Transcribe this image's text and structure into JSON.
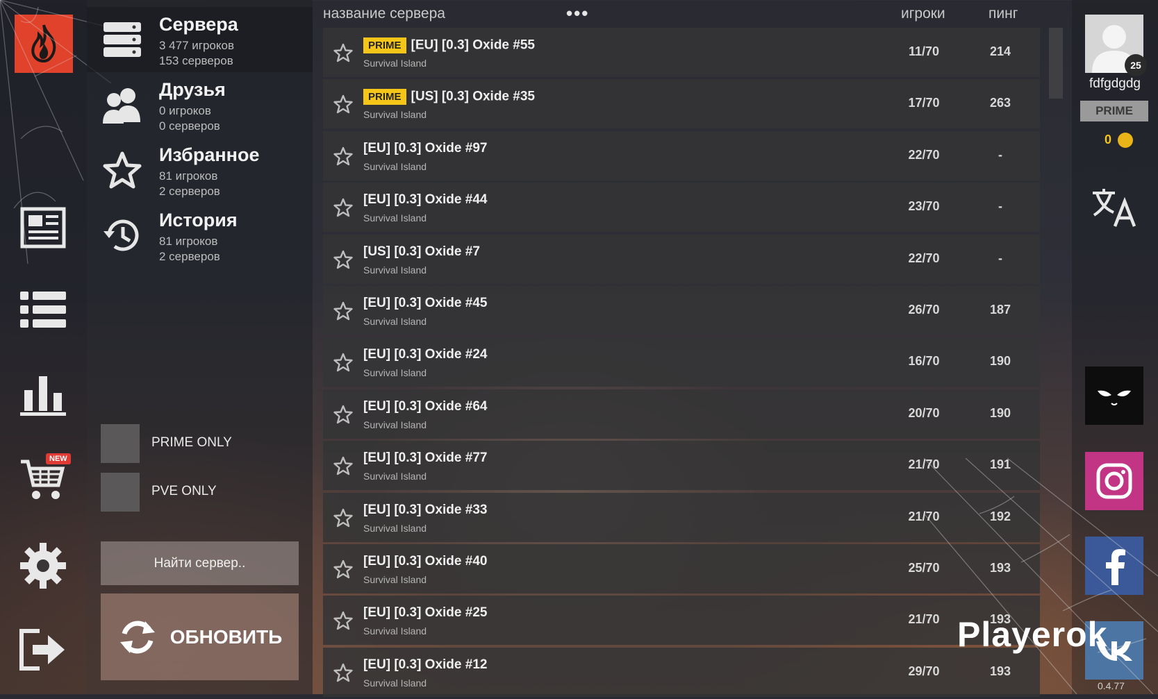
{
  "categories": [
    {
      "title": "Сервера",
      "sub1": "3 477 игроков",
      "sub2": "153 серверов",
      "icon": "servers-icon",
      "active": true
    },
    {
      "title": "Друзья",
      "sub1": "0 игроков",
      "sub2": "0 серверов",
      "icon": "friends-icon"
    },
    {
      "title": "Избранное",
      "sub1": "81 игроков",
      "sub2": "2 серверов",
      "icon": "star-icon"
    },
    {
      "title": "История",
      "sub1": "81 игроков",
      "sub2": "2 серверов",
      "icon": "history-icon"
    }
  ],
  "filters": {
    "prime_only": "PRIME ONLY",
    "pve_only": "PVE ONLY"
  },
  "find_server": "Найти сервер..",
  "refresh": "ОБНОВИТЬ",
  "header": {
    "name": "название сервера",
    "more": "•••",
    "players": "игроки",
    "ping": "пинг"
  },
  "servers": [
    {
      "prime": "PRIME",
      "name": "[EU] [0.3] Oxide #55",
      "map": "Survival Island",
      "players": "11/70",
      "ping": "214"
    },
    {
      "prime": "PRIME",
      "name": "[US] [0.3] Oxide #35",
      "map": "Survival Island",
      "players": "17/70",
      "ping": "263"
    },
    {
      "prime": "",
      "name": "[EU] [0.3] Oxide #97",
      "map": "Survival Island",
      "players": "22/70",
      "ping": "-"
    },
    {
      "prime": "",
      "name": "[EU] [0.3] Oxide #44",
      "map": "Survival Island",
      "players": "23/70",
      "ping": "-"
    },
    {
      "prime": "",
      "name": "[US] [0.3] Oxide #7",
      "map": "Survival Island",
      "players": "22/70",
      "ping": "-"
    },
    {
      "prime": "",
      "name": "[EU] [0.3] Oxide #45",
      "map": "Survival Island",
      "players": "26/70",
      "ping": "187"
    },
    {
      "prime": "",
      "name": "[EU] [0.3] Oxide #24",
      "map": "Survival Island",
      "players": "16/70",
      "ping": "190"
    },
    {
      "prime": "",
      "name": "[EU] [0.3] Oxide #64",
      "map": "Survival Island",
      "players": "20/70",
      "ping": "190"
    },
    {
      "prime": "",
      "name": "[EU] [0.3] Oxide #77",
      "map": "Survival Island",
      "players": "21/70",
      "ping": "191"
    },
    {
      "prime": "",
      "name": "[EU] [0.3] Oxide #33",
      "map": "Survival Island",
      "players": "21/70",
      "ping": "192"
    },
    {
      "prime": "",
      "name": "[EU] [0.3] Oxide #40",
      "map": "Survival Island",
      "players": "25/70",
      "ping": "193"
    },
    {
      "prime": "",
      "name": "[EU] [0.3] Oxide #25",
      "map": "Survival Island",
      "players": "21/70",
      "ping": "193"
    },
    {
      "prime": "",
      "name": "[EU] [0.3] Oxide #12",
      "map": "Survival Island",
      "players": "29/70",
      "ping": "193"
    }
  ],
  "profile": {
    "username": "fdfgdgdg",
    "level": "25",
    "prime": "PRIME",
    "coins": "0"
  },
  "new_badge": "NEW",
  "watermark": "Playerok",
  "version": "0.4.77",
  "colors": {
    "accent": "#e0422c",
    "prime": "#f5c518",
    "instagram": "#c13584",
    "facebook": "#3b5998",
    "vk": "#4c75a3"
  }
}
